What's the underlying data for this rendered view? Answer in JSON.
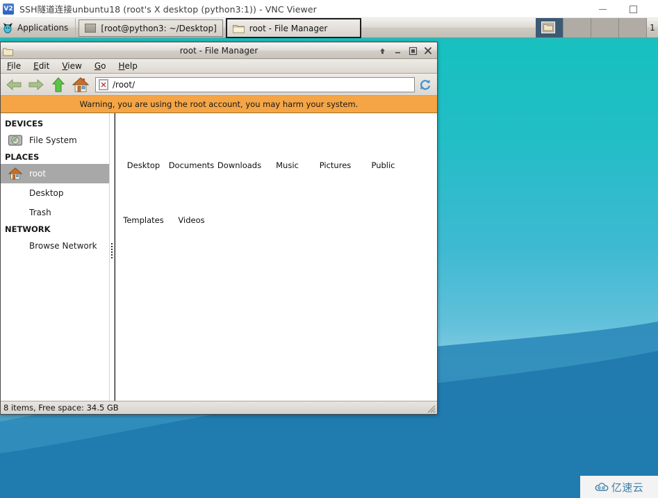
{
  "vnc": {
    "title": "SSH隧道连接unbuntu18 (root's X desktop (python3:1)) - VNC Viewer",
    "app_icon": "vnc-viewer-icon",
    "minimize_label": "Minimize",
    "maximize_label": "Maximize"
  },
  "panel": {
    "applications_label": "Applications",
    "applications_icon": "mouse-icon",
    "tasks": [
      {
        "label": "[root@python3: ~/Desktop]",
        "icon": "terminal-icon",
        "active": false
      },
      {
        "label": "root - File Manager",
        "icon": "folder-icon",
        "active": true
      }
    ],
    "workspaces": [
      {
        "name": "workspace-1",
        "active": true,
        "has_window": true
      },
      {
        "name": "workspace-2",
        "active": false,
        "has_window": false
      },
      {
        "name": "workspace-3",
        "active": false,
        "has_window": false
      },
      {
        "name": "workspace-4",
        "active": false,
        "has_window": false
      }
    ],
    "clock": "1"
  },
  "filemanager": {
    "title": "root - File Manager",
    "window_icon": "folder-icon",
    "controls": {
      "shade_label": "Shade",
      "minimize_label": "Minimize",
      "maximize_label": "Maximize",
      "close_label": "Close"
    },
    "menu": [
      {
        "label": "File",
        "mnemonic": "F"
      },
      {
        "label": "Edit",
        "mnemonic": "E"
      },
      {
        "label": "View",
        "mnemonic": "V"
      },
      {
        "label": "Go",
        "mnemonic": "G"
      },
      {
        "label": "Help",
        "mnemonic": "H"
      }
    ],
    "toolbar": {
      "back_label": "Back",
      "forward_label": "Forward",
      "up_label": "Open Parent Folder",
      "home_label": "Home",
      "reload_label": "Reload"
    },
    "path": {
      "value": "/root/",
      "placeholder": "/root/",
      "icon": "broken-image-icon"
    },
    "warning": "Warning, you are using the root account, you may harm your system.",
    "sidebar": {
      "sections": [
        {
          "header": "DEVICES",
          "items": [
            {
              "label": "File System",
              "icon": "harddisk-icon",
              "selected": false
            }
          ]
        },
        {
          "header": "PLACES",
          "items": [
            {
              "label": "root",
              "icon": "home-folder-icon",
              "selected": true
            },
            {
              "label": "Desktop",
              "icon": "",
              "selected": false
            },
            {
              "label": "Trash",
              "icon": "",
              "selected": false
            }
          ]
        },
        {
          "header": "NETWORK",
          "items": [
            {
              "label": "Browse Network",
              "icon": "",
              "selected": false
            }
          ]
        }
      ]
    },
    "files": [
      {
        "label": "Desktop",
        "icon": "folder-icon"
      },
      {
        "label": "Documents",
        "icon": "folder-icon"
      },
      {
        "label": "Downloads",
        "icon": "folder-icon"
      },
      {
        "label": "Music",
        "icon": "folder-icon"
      },
      {
        "label": "Pictures",
        "icon": "folder-icon"
      },
      {
        "label": "Public",
        "icon": "folder-icon"
      },
      {
        "label": "Templates",
        "icon": "folder-icon"
      },
      {
        "label": "Videos",
        "icon": "folder-icon"
      }
    ],
    "statusbar": "8 items, Free space: 34.5 GB"
  },
  "watermark": {
    "text": "亿速云",
    "icon": "cloud-icon"
  },
  "colors": {
    "warning_bar": "#f5a545",
    "selection": "#a8a8a8",
    "desktop_top": "#17c0c0",
    "desktop_bottom": "#1f79ad",
    "panel_active_workspace": "#3d5a73",
    "watermark_text": "#3f7fa6"
  }
}
